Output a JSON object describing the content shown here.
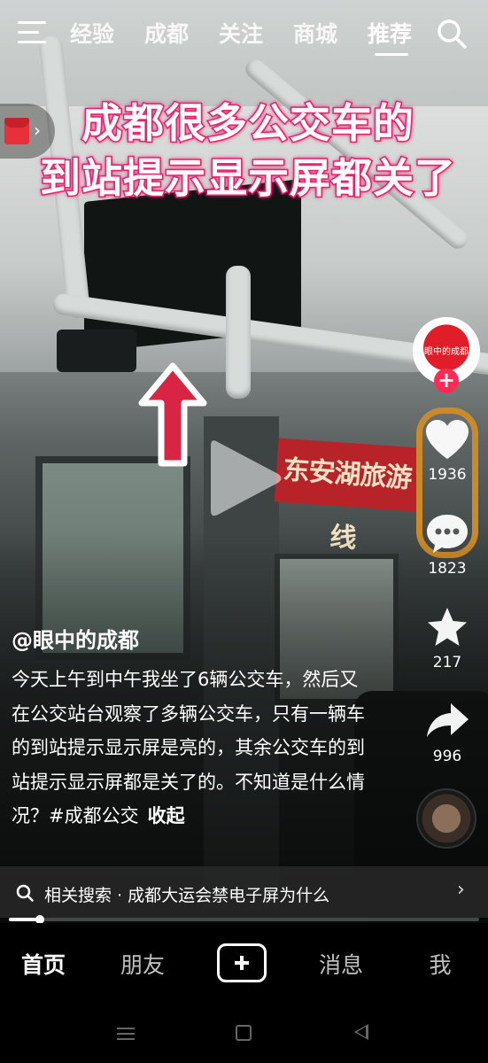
{
  "topnav": {
    "tabs": [
      {
        "label": "经验"
      },
      {
        "label": "成都"
      },
      {
        "label": "关注"
      },
      {
        "label": "商城"
      },
      {
        "label": "推荐",
        "active": true
      }
    ]
  },
  "video": {
    "title_line1": "成都很多公交车的",
    "title_line2": "到站提示显示屏都关了",
    "sign_text": "东安湖旅游线"
  },
  "actions": {
    "avatar_text": "眼中的成都",
    "likes": "1936",
    "comments": "1823",
    "favorites": "217",
    "shares": "996"
  },
  "caption": {
    "author": "@眼中的成都",
    "text": "今天上午到中午我坐了6辆公交车，然后又在公交站台观察了多辆公交车，只有一辆车的到站提示显示屏是亮的，其余公交车的到站提示显示屏都是关了的。不知道是什么情况？#成都公交",
    "fold_label": "收起"
  },
  "related": {
    "text": "相关搜索 · 成都大运会禁电子屏为什么"
  },
  "progress": 0.065,
  "tabbar": {
    "home": "首页",
    "friends": "朋友",
    "messages": "消息",
    "me": "我"
  },
  "colors": {
    "accent": "#fe2c55",
    "title_stroke": "#e8226d"
  }
}
